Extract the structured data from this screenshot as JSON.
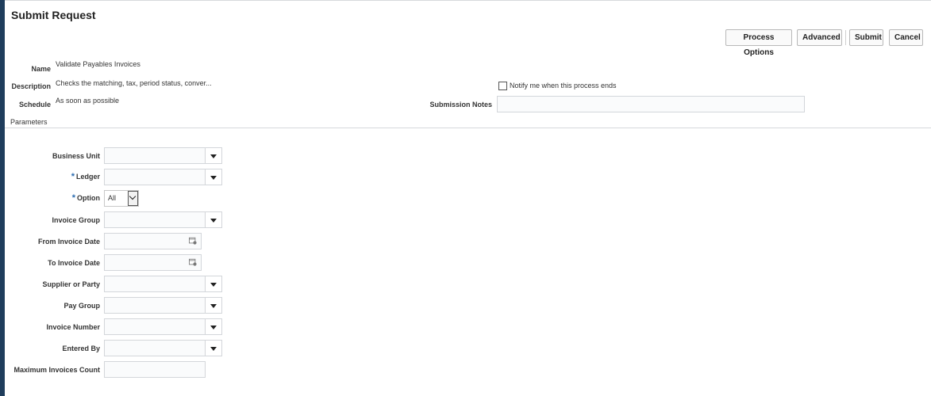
{
  "page": {
    "title": "Submit Request"
  },
  "toolbar": {
    "process_options": "Process Options",
    "advanced": "Advanced",
    "submit": "Submit",
    "cancel": "Cancel"
  },
  "details": {
    "name_label": "Name",
    "name_value": "Validate Payables Invoices",
    "description_label": "Description",
    "description_value": "Checks the matching, tax, period status, conver...",
    "schedule_label": "Schedule",
    "schedule_value": "As soon as possible",
    "notify_label": "Notify me when this process ends",
    "notify_checked": false,
    "submission_notes_label": "Submission Notes",
    "submission_notes_value": ""
  },
  "parameters": {
    "section_label": "Parameters",
    "fields": [
      {
        "label": "Business Unit",
        "required": false,
        "type": "combo",
        "value": ""
      },
      {
        "label": "Ledger",
        "required": true,
        "type": "combo",
        "value": ""
      },
      {
        "label": "Option",
        "required": true,
        "type": "select",
        "value": "All"
      },
      {
        "label": "Invoice Group",
        "required": false,
        "type": "combo",
        "value": ""
      },
      {
        "label": "From Invoice Date",
        "required": false,
        "type": "date",
        "value": ""
      },
      {
        "label": "To Invoice Date",
        "required": false,
        "type": "date",
        "value": ""
      },
      {
        "label": "Supplier or Party",
        "required": false,
        "type": "combo",
        "value": ""
      },
      {
        "label": "Pay Group",
        "required": false,
        "type": "combo",
        "value": ""
      },
      {
        "label": "Invoice Number",
        "required": false,
        "type": "combo",
        "value": ""
      },
      {
        "label": "Entered By",
        "required": false,
        "type": "combo",
        "value": ""
      },
      {
        "label": "Maximum Invoices Count",
        "required": false,
        "type": "text",
        "value": ""
      }
    ],
    "required_marker": "*"
  },
  "icons": {
    "calendar": "calendar-icon",
    "dropdown": "chevron-down-icon"
  },
  "colors": {
    "left_edge": "#1f3d5c",
    "required_marker": "#2b6cb0"
  }
}
